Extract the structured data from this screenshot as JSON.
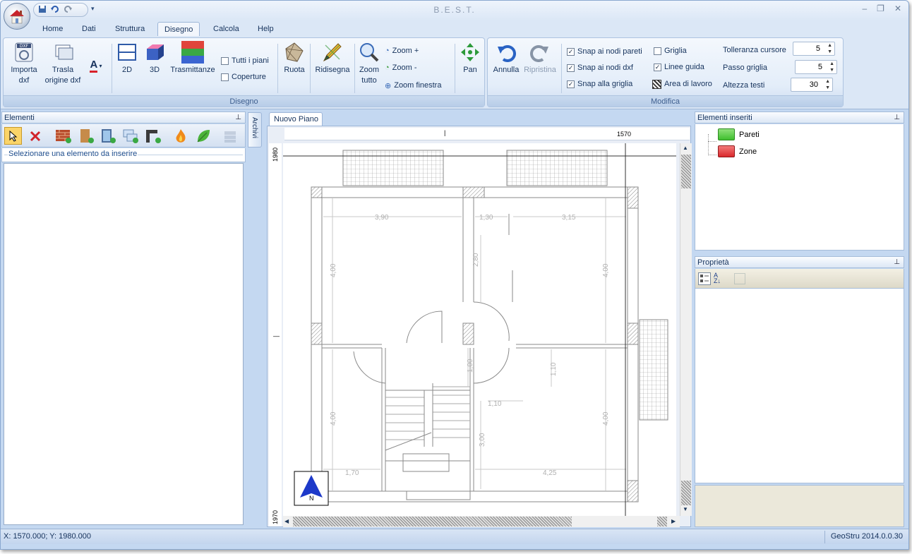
{
  "app": {
    "title": "B.E.S.T."
  },
  "window_controls": {
    "minimize": "–",
    "restore": "❐",
    "close": "✕"
  },
  "tabs": [
    "Home",
    "Dati",
    "Struttura",
    "Disegno",
    "Calcola",
    "Help"
  ],
  "active_tab": "Disegno",
  "ribbon": {
    "disegno_group": "Disegno",
    "modifica_group": "Modifica",
    "importa": [
      "Importa",
      "dxf"
    ],
    "dxf_badge": "DXF",
    "trasla": [
      "Trasla",
      "origine dxf"
    ],
    "font_color_glyph": "A",
    "view_2d": "2D",
    "view_3d": "3D",
    "trasmittanze": "Trasmittanze",
    "tutti_piani": "Tutti i piani",
    "coperture": "Coperture",
    "ruota": "Ruota",
    "ridisegna": "Ridisegna",
    "zoom_tutto": [
      "Zoom",
      "tutto"
    ],
    "zoom_plus": "Zoom +",
    "zoom_minus": "Zoom -",
    "zoom_finestra": "Zoom finestra",
    "pan": "Pan",
    "annulla": "Annulla",
    "ripristina": "Ripristina",
    "snap_nodi_pareti": "Snap ai nodi pareti",
    "snap_nodi_dxf": "Snap ai nodi dxf",
    "snap_griglia": "Snap alla griglia",
    "griglia": "Griglia",
    "linee_guida": "Linee guida",
    "area_lavoro": "Area di lavoro",
    "tolleranza_cursore": {
      "label": "Tolleranza cursore",
      "value": "5"
    },
    "passo_griglia": {
      "label": "Passo griglia",
      "value": "5"
    },
    "altezza_testi": {
      "label": "Altezza testi",
      "value": "30"
    },
    "checkmark": "✓"
  },
  "left_panel": {
    "title": "Elementi",
    "pin": "⊥",
    "subtitle": "Selezionare una elemento da inserire"
  },
  "archivi": "Archivi",
  "document": {
    "tab": "Nuovo Piano",
    "ruler_top": {
      "tick_label": "1570"
    },
    "ruler_left": {
      "top_label": "1980",
      "bottom_label": "1970"
    },
    "north": "N",
    "dimensions": [
      "3,90",
      "1,30",
      "3,15",
      "4,00",
      "2,80",
      "4,00",
      "1,00",
      "1,10",
      "1,10",
      "4,00",
      "3,00",
      "4,00",
      "1,70",
      "4,25"
    ]
  },
  "right_top": {
    "title": "Elementi inseriti",
    "items": [
      {
        "label": "Pareti",
        "color": "#3fbf2f"
      },
      {
        "label": "Zone",
        "color": "#d9282c"
      }
    ]
  },
  "right_bottom": {
    "title": "Proprietà"
  },
  "status": {
    "coords": "X: 1570.000; Y: 1980.000",
    "version": "GeoStru 2014.0.0.30"
  }
}
